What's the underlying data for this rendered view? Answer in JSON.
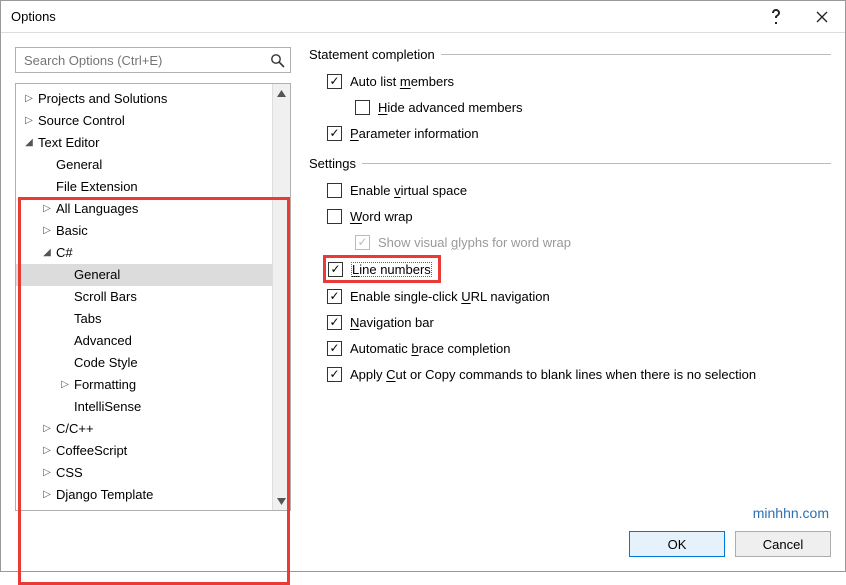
{
  "window": {
    "title": "Options"
  },
  "search": {
    "placeholder": "Search Options (Ctrl+E)"
  },
  "tree": [
    {
      "label": "Projects and Solutions",
      "depth": 0,
      "glyph": "▷"
    },
    {
      "label": "Source Control",
      "depth": 0,
      "glyph": "▷"
    },
    {
      "label": "Text Editor",
      "depth": 0,
      "glyph": "◢"
    },
    {
      "label": "General",
      "depth": 1,
      "glyph": ""
    },
    {
      "label": "File Extension",
      "depth": 1,
      "glyph": ""
    },
    {
      "label": "All Languages",
      "depth": 1,
      "glyph": "▷"
    },
    {
      "label": "Basic",
      "depth": 1,
      "glyph": "▷"
    },
    {
      "label": "C#",
      "depth": 1,
      "glyph": "◢"
    },
    {
      "label": "General",
      "depth": 2,
      "glyph": "",
      "selected": true
    },
    {
      "label": "Scroll Bars",
      "depth": 2,
      "glyph": ""
    },
    {
      "label": "Tabs",
      "depth": 2,
      "glyph": ""
    },
    {
      "label": "Advanced",
      "depth": 2,
      "glyph": ""
    },
    {
      "label": "Code Style",
      "depth": 2,
      "glyph": ""
    },
    {
      "label": "Formatting",
      "depth": 2,
      "glyph": "▷"
    },
    {
      "label": "IntelliSense",
      "depth": 2,
      "glyph": ""
    },
    {
      "label": "C/C++",
      "depth": 1,
      "glyph": "▷"
    },
    {
      "label": "CoffeeScript",
      "depth": 1,
      "glyph": "▷"
    },
    {
      "label": "CSS",
      "depth": 1,
      "glyph": "▷"
    },
    {
      "label": "Django Template",
      "depth": 1,
      "glyph": "▷"
    }
  ],
  "groups": {
    "statement": {
      "title": "Statement completion",
      "auto_list": "Auto list members",
      "hide_adv": "Hide advanced members",
      "param_info": "Parameter information"
    },
    "settings": {
      "title": "Settings",
      "virtual": "Enable virtual space",
      "wrap": "Word wrap",
      "glyphs": "Show visual glyphs for word wrap",
      "linenum": "Line numbers",
      "urlnav": "Enable single-click URL navigation",
      "navbar": "Navigation bar",
      "brace": "Automatic brace completion",
      "cutcopy": "Apply Cut or Copy commands to blank lines when there is no selection"
    }
  },
  "buttons": {
    "ok": "OK",
    "cancel": "Cancel"
  },
  "watermark": "minhhn.com"
}
